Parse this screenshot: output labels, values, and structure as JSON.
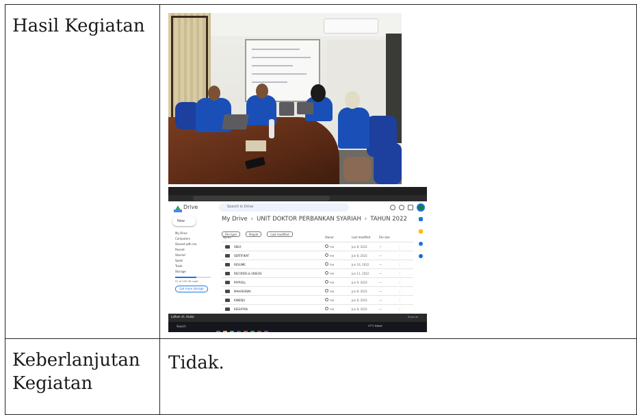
{
  "rows": [
    {
      "label": "Hasil Kegiatan",
      "value": ""
    },
    {
      "label": "Keberlanjutan Kegiatan",
      "value": "Tidak."
    }
  ],
  "screenshot": {
    "app_name": "Drive",
    "search_placeholder": "Search in Drive",
    "new_label": "New",
    "sidebar": [
      "My Drive",
      "Computers",
      "Shared with me",
      "Recent",
      "Starred",
      "Spam",
      "Trash",
      "Storage"
    ],
    "storage_text": "51 of 100 GB used",
    "storage_button": "Get more storage",
    "breadcrumb": [
      "My Drive",
      "UNIT DOKTOR PERBANKAN SYARIAH",
      "TAHUN 2022"
    ],
    "filters": [
      "File type",
      "People",
      "Last modified"
    ],
    "columns": {
      "name": "Name",
      "owner": "Owner",
      "modified": "Last modified",
      "size": "File size"
    },
    "folders": [
      {
        "name": "SKEA",
        "owner": "me",
        "modified": "Jun 8, 2022",
        "size": "—"
      },
      {
        "name": "SERTIFIKAT",
        "owner": "me",
        "modified": "Jun 8, 2022",
        "size": "—"
      },
      {
        "name": "RESUME",
        "owner": "me",
        "modified": "Jun 16, 2022",
        "size": "—"
      },
      {
        "name": "RECORDS & VIDEOS",
        "owner": "me",
        "modified": "Jun 11, 2022",
        "size": "—"
      },
      {
        "name": "PAYROLL",
        "owner": "me",
        "modified": "Jun 9, 2022",
        "size": "—"
      },
      {
        "name": "MAHASISWA",
        "owner": "me",
        "modified": "Jun 8, 2022",
        "size": "—"
      },
      {
        "name": "KINERJA",
        "owner": "me",
        "modified": "Jun 8, 2022",
        "size": "—"
      },
      {
        "name": "KEGIATAN",
        "owner": "me",
        "modified": "Jun 8, 2022",
        "size": "—"
      }
    ],
    "download_file": "Laflam ch. Hukbi",
    "download_show_all": "Show all",
    "taskbar_search": "Search",
    "taskbar_weather": "27°C Kabut"
  }
}
